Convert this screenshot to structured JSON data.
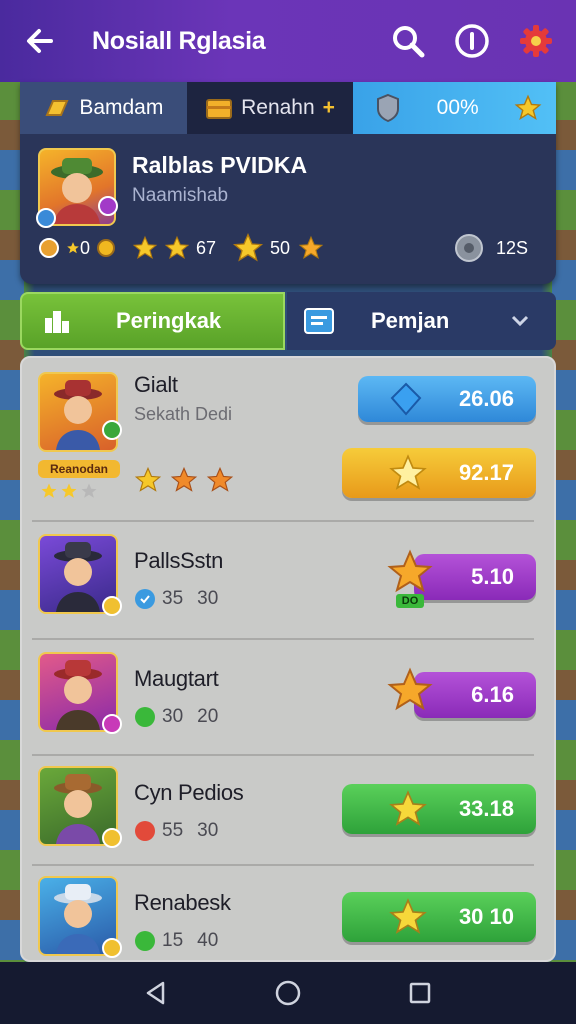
{
  "topbar": {
    "title": "Nosiall Rglasia"
  },
  "currency": {
    "item1": {
      "label": "Bamdam",
      "icon": "gold-bar-icon"
    },
    "item2": {
      "label": "Renahn",
      "icon": "chest-icon"
    },
    "item3": {
      "label": "00%",
      "icon": "shield-icon"
    }
  },
  "profile": {
    "name": "Ralblas PVIDKA",
    "subtitle": "Naamishab",
    "stat1": "0",
    "stat2": "67",
    "stat3": "50",
    "stat4": "12S"
  },
  "tabs": {
    "active": "Peringkak",
    "other": "Pemjan"
  },
  "rows": [
    {
      "name": "Gialt",
      "sub": "Sekath Dedi",
      "badge": "Reanodan",
      "pill": "26.06",
      "pill2": "92.17",
      "stars": 3
    },
    {
      "name": "PallsSstn",
      "a": "35",
      "b": "30",
      "pill": "5.10",
      "pill_icon_label": "DO"
    },
    {
      "name": "Maugtart",
      "a": "30",
      "b": "20",
      "pill": "6.16"
    },
    {
      "name": "Cyn Pedios",
      "a": "55",
      "b": "30",
      "pill": "33.18"
    },
    {
      "name": "Renabesk",
      "a": "15",
      "b": "40",
      "pill": "30 10"
    }
  ],
  "colors": {
    "topbar": "#6b35b8",
    "green": "#59a228",
    "purple": "#9a35c0",
    "blue": "#39a2e8",
    "gold": "#f0b820"
  }
}
